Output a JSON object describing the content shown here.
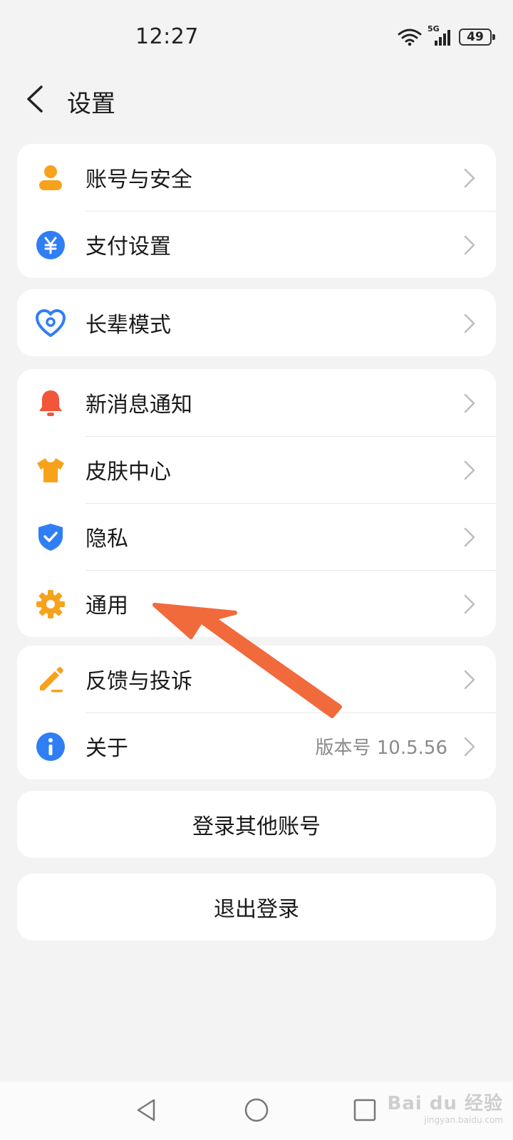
{
  "status": {
    "time": "12:27",
    "battery": "49",
    "network": "5G"
  },
  "header": {
    "title": "设置"
  },
  "groups": [
    {
      "items": [
        {
          "label": "账号与安全",
          "icon": "person-icon"
        },
        {
          "label": "支付设置",
          "icon": "yuan-icon"
        }
      ]
    },
    {
      "items": [
        {
          "label": "长辈模式",
          "icon": "heart-icon"
        }
      ]
    },
    {
      "items": [
        {
          "label": "新消息通知",
          "icon": "bell-icon"
        },
        {
          "label": "皮肤中心",
          "icon": "shirt-icon"
        },
        {
          "label": "隐私",
          "icon": "shield-icon"
        },
        {
          "label": "通用",
          "icon": "gear-icon"
        }
      ]
    },
    {
      "items": [
        {
          "label": "反馈与投诉",
          "icon": "pencil-icon"
        },
        {
          "label": "关于",
          "icon": "info-icon",
          "value": "版本号 10.5.56"
        }
      ]
    }
  ],
  "actions": {
    "switch_account": "登录其他账号",
    "logout": "退出登录"
  },
  "watermark": {
    "main": "Bai du 经验",
    "sub": "jingyan.baidu.com"
  },
  "colors": {
    "background": "#f3f3f3",
    "annotation_arrow": "#f06a3c",
    "accent_blue": "#2f7ef5",
    "accent_orange": "#f7a21b",
    "bell_red": "#f2553a"
  }
}
